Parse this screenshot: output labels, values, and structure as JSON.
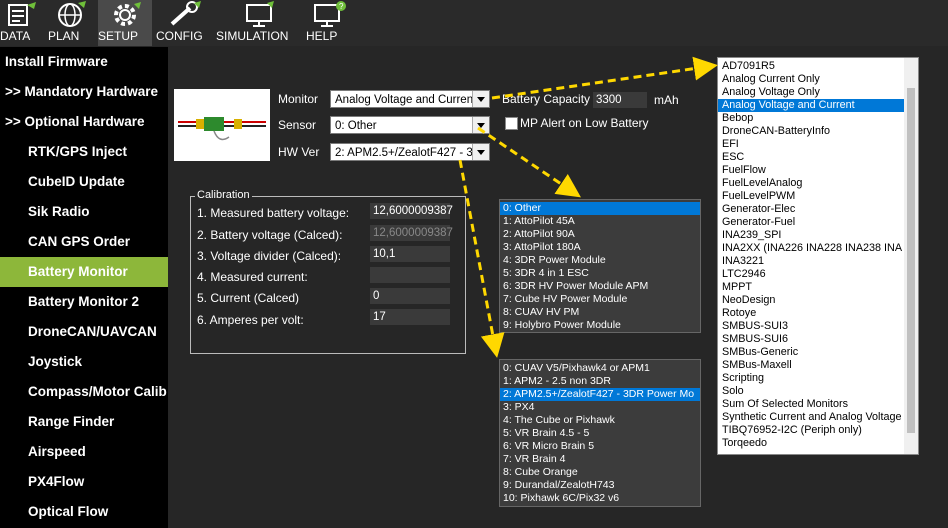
{
  "topbar": {
    "buttons": [
      {
        "label": "DATA"
      },
      {
        "label": "PLAN"
      },
      {
        "label": "SETUP"
      },
      {
        "label": "CONFIG"
      },
      {
        "label": "SIMULATION"
      },
      {
        "label": "HELP"
      }
    ]
  },
  "sidebar": {
    "items": [
      {
        "label": "Install Firmware"
      },
      {
        "label": ">> Mandatory Hardware"
      },
      {
        "label": ">> Optional Hardware"
      },
      {
        "label": "RTK/GPS Inject"
      },
      {
        "label": "CubeID Update"
      },
      {
        "label": "Sik Radio"
      },
      {
        "label": "CAN GPS Order"
      },
      {
        "label": "Battery Monitor"
      },
      {
        "label": "Battery Monitor 2"
      },
      {
        "label": "DroneCAN/UAVCAN"
      },
      {
        "label": "Joystick"
      },
      {
        "label": "Compass/Motor Calib"
      },
      {
        "label": "Range Finder"
      },
      {
        "label": "Airspeed"
      },
      {
        "label": "PX4Flow"
      },
      {
        "label": "Optical Flow"
      }
    ]
  },
  "form": {
    "monitor_label": "Monitor",
    "monitor_value": "Analog Voltage and Current",
    "sensor_label": "Sensor",
    "sensor_value": "0: Other",
    "hwver_label": "HW Ver",
    "hwver_value": "2: APM2.5+/ZealotF427 - 3D",
    "capacity_label": "Battery Capacity",
    "capacity_value": "3300",
    "capacity_unit": "mAh",
    "alert_label": "MP Alert on Low Battery"
  },
  "calibration": {
    "title": "Calibration",
    "rows": [
      {
        "label": "1. Measured battery voltage:",
        "value": "12,6000009387"
      },
      {
        "label": "2. Battery voltage (Calced):",
        "value": "12,6000009387"
      },
      {
        "label": "3. Voltage divider (Calced):",
        "value": "10,1"
      },
      {
        "label": "4. Measured current:",
        "value": ""
      },
      {
        "label": "5. Current (Calced)",
        "value": "0"
      },
      {
        "label": "6. Amperes per volt:",
        "value": "17"
      }
    ]
  },
  "sensor_dropdown": [
    "0: Other",
    "1: AttoPilot 45A",
    "2: AttoPilot 90A",
    "3: AttoPilot 180A",
    "4: 3DR Power Module",
    "5: 3DR 4 in 1 ESC",
    "6: 3DR HV Power Module APM",
    "7: Cube HV Power Module",
    "8: CUAV HV PM",
    "9: Holybro Power Module"
  ],
  "hwver_dropdown": [
    "0: CUAV V5/Pixhawk4 or APM1",
    "1: APM2 - 2.5 non 3DR",
    "2: APM2.5+/ZealotF427 - 3DR Power Mo",
    "3: PX4",
    "4: The Cube or Pixhawk",
    "5: VR Brain 4.5 - 5",
    "6: VR Micro Brain 5",
    "7: VR Brain 4",
    "8: Cube Orange",
    "9: Durandal/ZealotH743",
    "10: Pixhawk 6C/Pix32 v6"
  ],
  "monitor_dropdown": [
    "AD7091R5",
    "Analog Current Only",
    "Analog Voltage Only",
    "Analog Voltage and Current",
    "Bebop",
    "DroneCAN-BatteryInfo",
    "EFI",
    "ESC",
    "FuelFlow",
    "FuelLevelAnalog",
    "FuelLevelPWM",
    "Generator-Elec",
    "Generator-Fuel",
    "INA239_SPI",
    "INA2XX (INA226 INA228 INA238 INA",
    "INA3221",
    "LTC2946",
    "MPPT",
    "NeoDesign",
    "Rotoye",
    "SMBUS-SUI3",
    "SMBUS-SUI6",
    "SMBus-Generic",
    "SMBus-Maxell",
    "Scripting",
    "Solo",
    "Sum Of Selected Monitors",
    "Synthetic Current and Analog Voltage",
    "TIBQ76952-I2C (Periph only)",
    "Torqeedo"
  ]
}
